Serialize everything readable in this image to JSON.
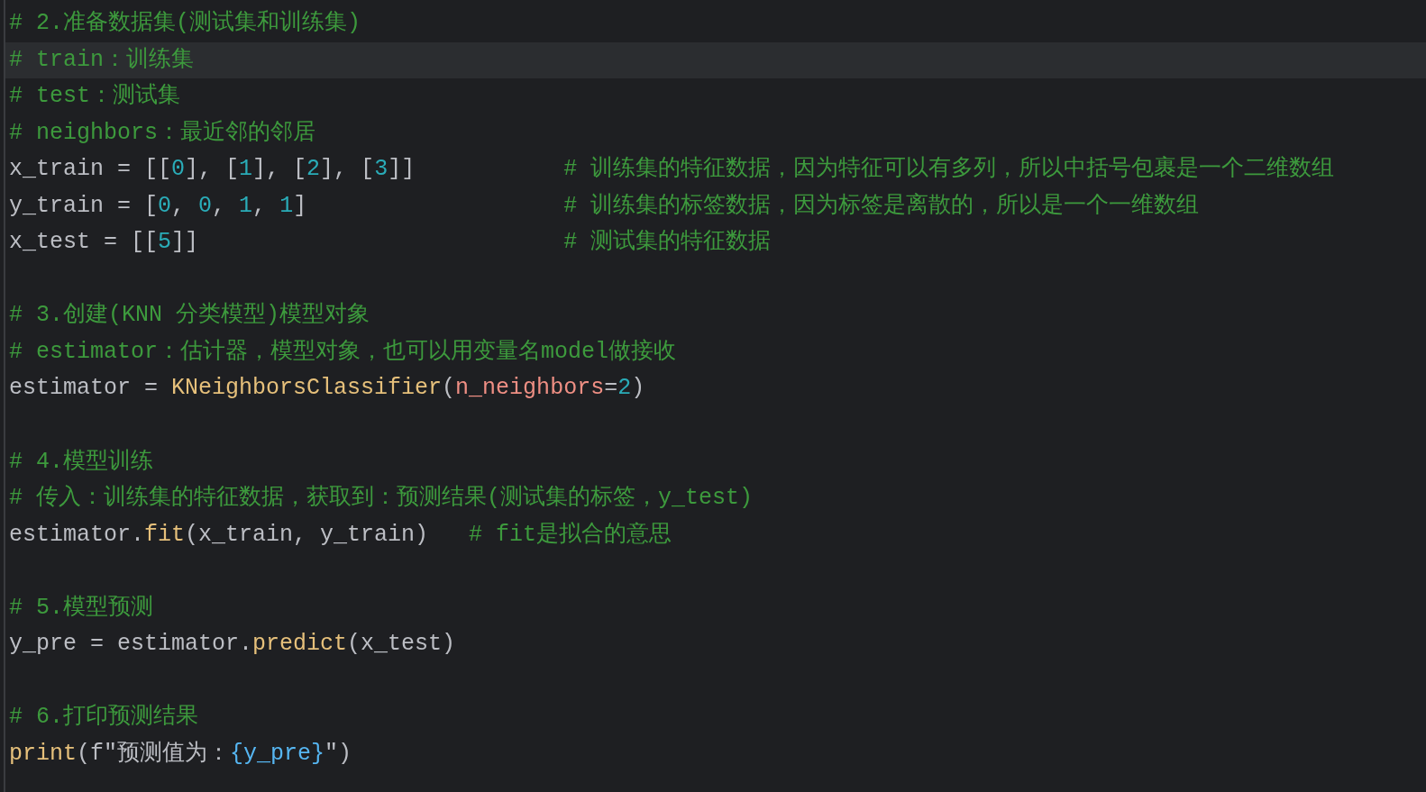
{
  "lines": [
    {
      "current": false,
      "tokens": [
        {
          "kind": "comment",
          "text": "# 2.准备数据集(测试集和训练集)"
        }
      ]
    },
    {
      "current": true,
      "tokens": [
        {
          "kind": "comment",
          "text": "# train：训练集"
        }
      ]
    },
    {
      "current": false,
      "tokens": [
        {
          "kind": "comment",
          "text": "# test：测试集"
        }
      ]
    },
    {
      "current": false,
      "tokens": [
        {
          "kind": "comment",
          "text": "# neighbors：最近邻的邻居"
        }
      ]
    },
    {
      "current": false,
      "tokens": [
        {
          "kind": "plain",
          "text": "x_train = [["
        },
        {
          "kind": "number",
          "text": "0"
        },
        {
          "kind": "plain",
          "text": "], ["
        },
        {
          "kind": "number",
          "text": "1"
        },
        {
          "kind": "plain",
          "text": "], ["
        },
        {
          "kind": "number",
          "text": "2"
        },
        {
          "kind": "plain",
          "text": "], ["
        },
        {
          "kind": "number",
          "text": "3"
        },
        {
          "kind": "plain",
          "text": "]]           "
        },
        {
          "kind": "comment",
          "text": "# 训练集的特征数据，因为特征可以有多列，所以中括号包裹是一个二维数组"
        }
      ]
    },
    {
      "current": false,
      "tokens": [
        {
          "kind": "plain",
          "text": "y_train = ["
        },
        {
          "kind": "number",
          "text": "0"
        },
        {
          "kind": "plain",
          "text": ", "
        },
        {
          "kind": "number",
          "text": "0"
        },
        {
          "kind": "plain",
          "text": ", "
        },
        {
          "kind": "number",
          "text": "1"
        },
        {
          "kind": "plain",
          "text": ", "
        },
        {
          "kind": "number",
          "text": "1"
        },
        {
          "kind": "plain",
          "text": "]                   "
        },
        {
          "kind": "comment",
          "text": "# 训练集的标签数据，因为标签是离散的，所以是一个一维数组"
        }
      ]
    },
    {
      "current": false,
      "tokens": [
        {
          "kind": "plain",
          "text": "x_test = [["
        },
        {
          "kind": "number",
          "text": "5"
        },
        {
          "kind": "plain",
          "text": "]]                           "
        },
        {
          "kind": "comment",
          "text": "# 测试集的特征数据"
        }
      ]
    },
    {
      "current": false
    },
    {
      "current": false,
      "tokens": [
        {
          "kind": "comment",
          "text": "# 3.创建(KNN 分类模型)模型对象"
        }
      ]
    },
    {
      "current": false,
      "tokens": [
        {
          "kind": "comment",
          "text": "# estimator：估计器，模型对象，也可以用变量名model做接收"
        }
      ]
    },
    {
      "current": false,
      "tokens": [
        {
          "kind": "plain",
          "text": "estimator = "
        },
        {
          "kind": "func",
          "text": "KNeighborsClassifier"
        },
        {
          "kind": "plain",
          "text": "("
        },
        {
          "kind": "param",
          "text": "n_neighbors"
        },
        {
          "kind": "plain",
          "text": "="
        },
        {
          "kind": "number",
          "text": "2"
        },
        {
          "kind": "plain",
          "text": ")"
        }
      ]
    },
    {
      "current": false
    },
    {
      "current": false,
      "tokens": [
        {
          "kind": "comment",
          "text": "# 4.模型训练"
        }
      ]
    },
    {
      "current": false,
      "tokens": [
        {
          "kind": "comment",
          "text": "# 传入：训练集的特征数据，获取到：预测结果(测试集的标签，y_test)"
        }
      ]
    },
    {
      "current": false,
      "tokens": [
        {
          "kind": "plain",
          "text": "estimator."
        },
        {
          "kind": "func",
          "text": "fit"
        },
        {
          "kind": "plain",
          "text": "(x_train, y_train)   "
        },
        {
          "kind": "comment",
          "text": "# fit是拟合的意思"
        }
      ]
    },
    {
      "current": false
    },
    {
      "current": false,
      "tokens": [
        {
          "kind": "comment",
          "text": "# 5.模型预测"
        }
      ]
    },
    {
      "current": false,
      "tokens": [
        {
          "kind": "plain",
          "text": "y_pre = estimator."
        },
        {
          "kind": "func",
          "text": "predict"
        },
        {
          "kind": "plain",
          "text": "(x_test)"
        }
      ]
    },
    {
      "current": false
    },
    {
      "current": false,
      "tokens": [
        {
          "kind": "comment",
          "text": "# 6.打印预测结果"
        }
      ]
    },
    {
      "current": false,
      "tokens": [
        {
          "kind": "func",
          "text": "print"
        },
        {
          "kind": "plain",
          "text": "(f\"预测值为："
        },
        {
          "kind": "interp",
          "text": "{y_pre}"
        },
        {
          "kind": "plain",
          "text": "\")"
        }
      ]
    }
  ]
}
